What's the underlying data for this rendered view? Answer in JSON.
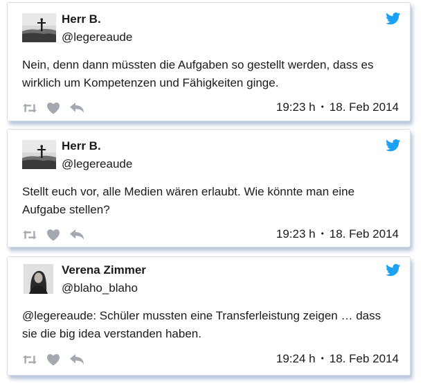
{
  "tweets": [
    {
      "name": "Herr B.",
      "handle": "@legereaude",
      "avatar": "statue-silhouette-avatar",
      "text": "Nein, denn dann müssten die Aufgaben so gestellt werden, dass es wirklich um Kompetenzen und Fähigkeiten ginge.",
      "time": "19:23 h",
      "date": "18. Feb 2014"
    },
    {
      "name": "Herr B.",
      "handle": "@legereaude",
      "avatar": "statue-silhouette-avatar",
      "text": "Stellt euch vor, alle Medien wären erlaubt. Wie könnte man eine Aufgabe stellen?",
      "time": "19:23 h",
      "date": "18. Feb 2014"
    },
    {
      "name": "Verena Zimmer",
      "handle": "@blaho_blaho",
      "avatar": "person-photo-avatar",
      "text": "@legereaude: Schüler mussten eine Transferleistung zeigen … dass sie die big idea verstanden haben.",
      "time": "19:24 h",
      "date": "18. Feb 2014"
    }
  ],
  "icons": {
    "brand": "twitter-bird-icon",
    "retweet": "retweet-icon",
    "like": "heart-icon",
    "reply": "reply-icon",
    "separator": "•"
  },
  "colors": {
    "twitter_blue": "#1da1f2",
    "action_gray": "#a3a9ae",
    "card_shadow": "#5a78aa"
  }
}
